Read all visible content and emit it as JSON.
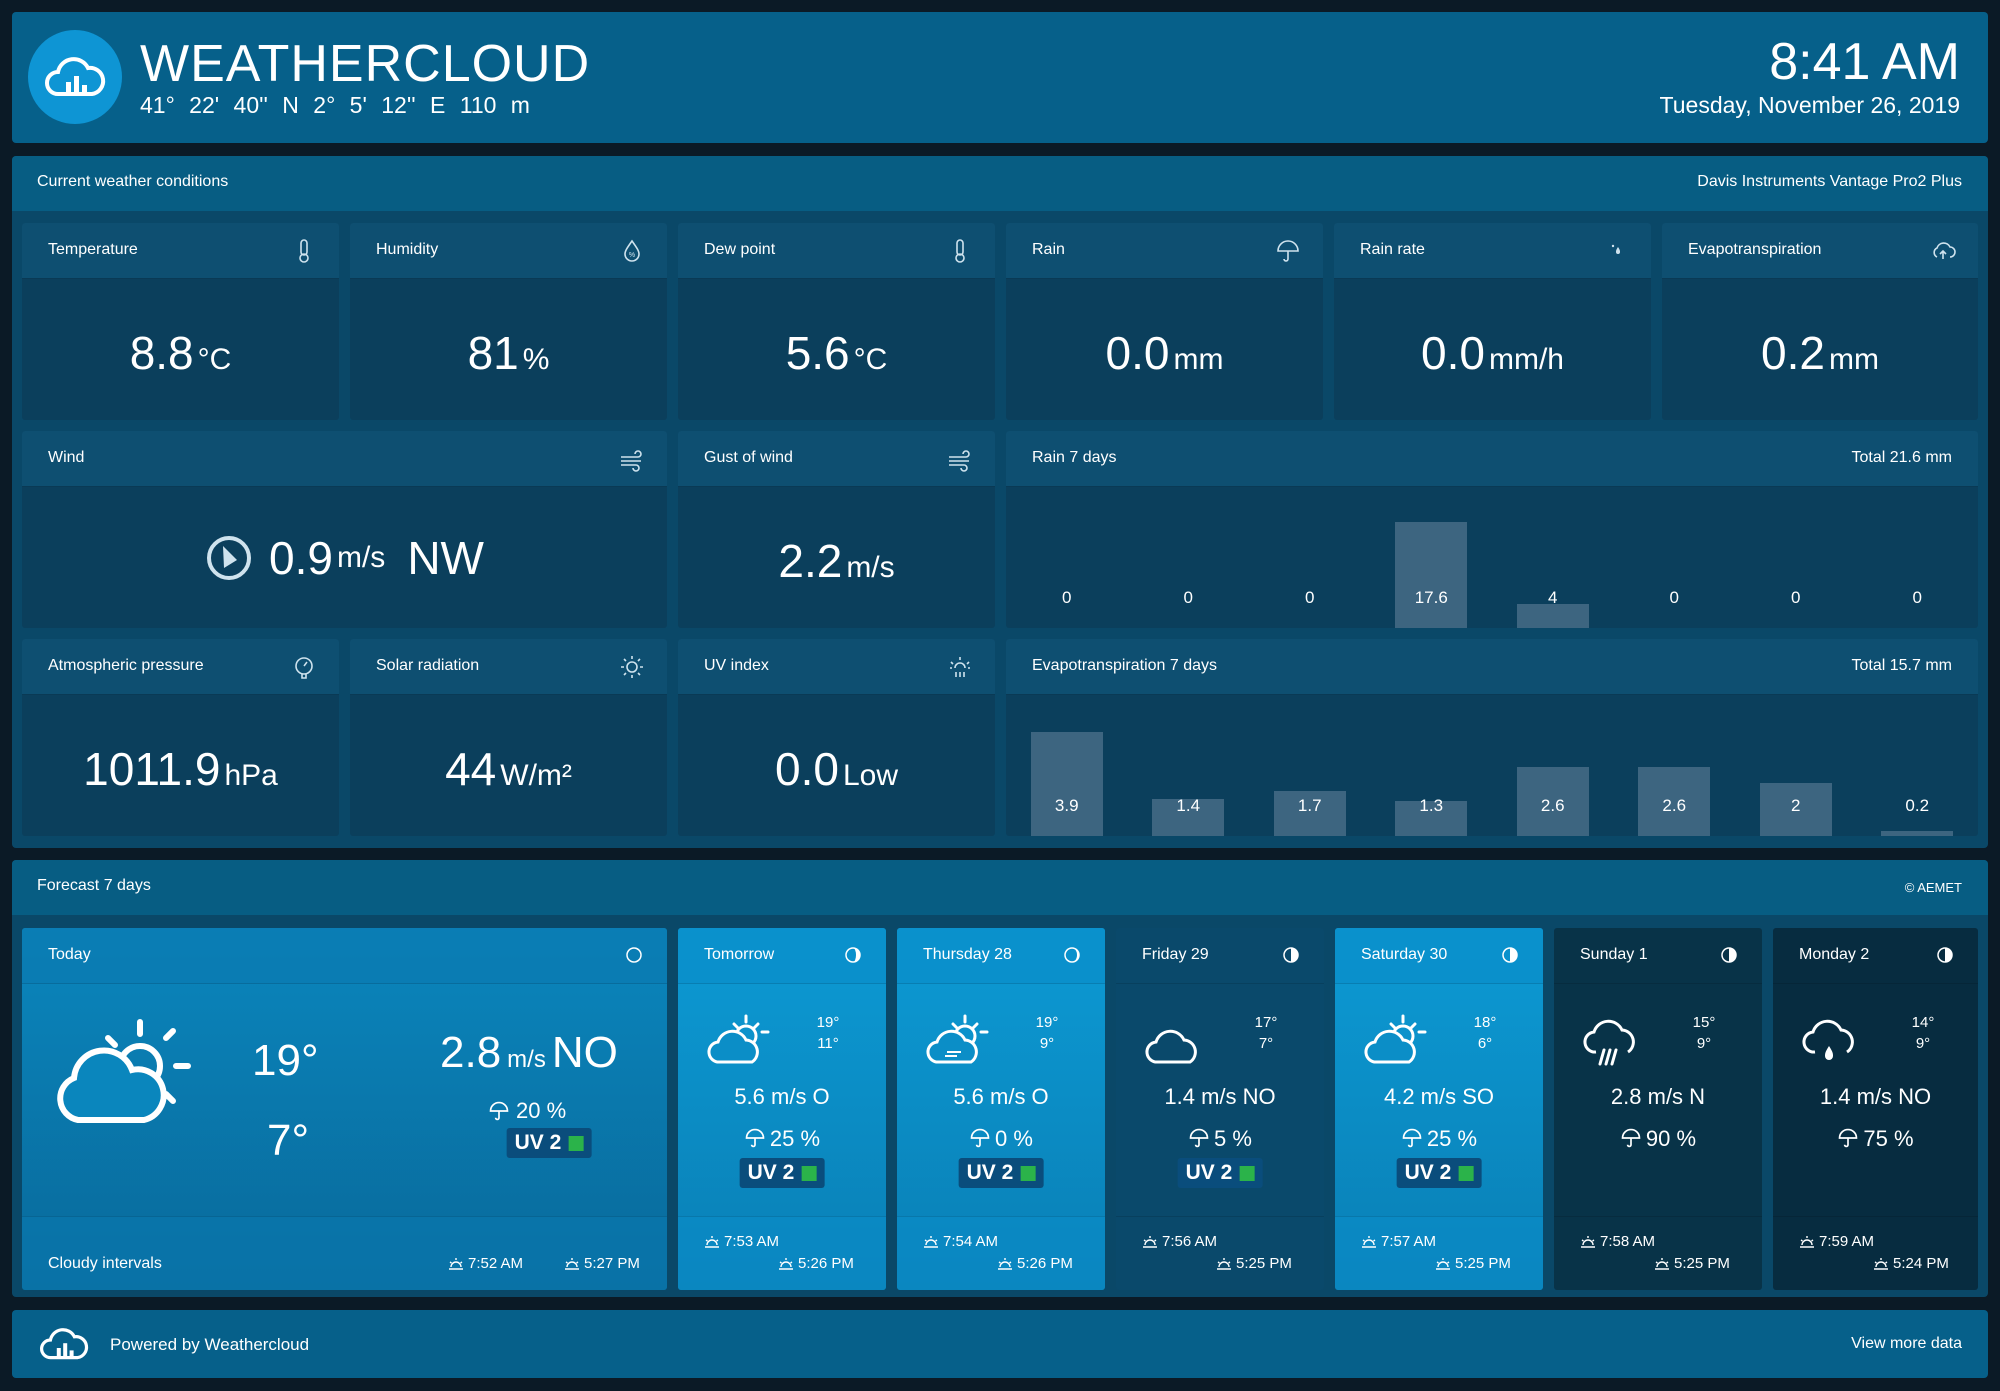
{
  "header": {
    "title": "WEATHERCLOUD",
    "coordinates": "41° 22' 40'' N   2° 5' 12'' E   110 m",
    "time": "8:41 AM",
    "date": "Tuesday, November 26, 2019"
  },
  "current": {
    "title": "Current weather conditions",
    "station": "Davis Instruments Vantage Pro2 Plus",
    "temperature": {
      "label": "Temperature",
      "value": "8.8",
      "unit": "°C"
    },
    "humidity": {
      "label": "Humidity",
      "value": "81",
      "unit": "%"
    },
    "dew_point": {
      "label": "Dew point",
      "value": "5.6",
      "unit": "°C"
    },
    "rain": {
      "label": "Rain",
      "value": "0.0",
      "unit": "mm"
    },
    "rain_rate": {
      "label": "Rain rate",
      "value": "0.0",
      "unit": "mm/h"
    },
    "evapotranspiration": {
      "label": "Evapotranspiration",
      "value": "0.2",
      "unit": "mm"
    },
    "wind": {
      "label": "Wind",
      "value": "0.9",
      "unit": "m/s",
      "direction": "NW"
    },
    "gust": {
      "label": "Gust of wind",
      "value": "2.2",
      "unit": "m/s"
    },
    "pressure": {
      "label": "Atmospheric pressure",
      "value": "1011.9",
      "unit": "hPa"
    },
    "solar": {
      "label": "Solar radiation",
      "value": "44",
      "unit": "W/m²"
    },
    "uv": {
      "label": "UV index",
      "value": "0.0",
      "unit": "Low"
    },
    "rain7": {
      "label": "Rain 7 days",
      "total": "Total 21.6 mm"
    },
    "evap7": {
      "label": "Evapotranspiration 7 days",
      "total": "Total 15.7 mm"
    }
  },
  "chart_data": [
    {
      "type": "bar",
      "title": "Rain 7 days",
      "values": [
        0,
        0,
        0,
        17.6,
        4,
        0,
        0,
        0
      ],
      "ylim": [
        0,
        20
      ]
    },
    {
      "type": "bar",
      "title": "Evapotranspiration 7 days",
      "values": [
        3.9,
        1.4,
        1.7,
        1.3,
        2.6,
        2.6,
        2,
        0.2
      ],
      "ylim": [
        0,
        4.5
      ]
    }
  ],
  "forecast": {
    "title": "Forecast 7 days",
    "source": "© AEMET",
    "today": {
      "day": "Today",
      "max": "19°",
      "min": "7°",
      "wind_value": "2.8",
      "wind_unit": "m/s",
      "wind_dir": "NO",
      "rain": "20 %",
      "uv_label": "UV",
      "uv": "2",
      "description": "Cloudy intervals",
      "sunrise": "7:52 AM",
      "sunset": "5:27 PM"
    },
    "days": [
      {
        "day": "Tomorrow",
        "max": "19°",
        "min": "11°",
        "wind": "5.6 m/s O",
        "rain": "25 %",
        "uv_label": "UV",
        "uv": "2",
        "sunrise": "7:53 AM",
        "sunset": "5:26 PM"
      },
      {
        "day": "Thursday 28",
        "max": "19°",
        "min": "9°",
        "wind": "5.6 m/s O",
        "rain": "0 %",
        "uv_label": "UV",
        "uv": "2",
        "sunrise": "7:54 AM",
        "sunset": "5:26 PM"
      },
      {
        "day": "Friday 29",
        "max": "17°",
        "min": "7°",
        "wind": "1.4 m/s NO",
        "rain": "5 %",
        "uv_label": "UV",
        "uv": "2",
        "sunrise": "7:56 AM",
        "sunset": "5:25 PM"
      },
      {
        "day": "Saturday 30",
        "max": "18°",
        "min": "6°",
        "wind": "4.2 m/s SO",
        "rain": "25 %",
        "uv_label": "UV",
        "uv": "2",
        "sunrise": "7:57 AM",
        "sunset": "5:25 PM"
      },
      {
        "day": "Sunday 1",
        "max": "15°",
        "min": "9°",
        "wind": "2.8 m/s N",
        "rain": "90 %",
        "sunrise": "7:58 AM",
        "sunset": "5:25 PM"
      },
      {
        "day": "Monday 2",
        "max": "14°",
        "min": "9°",
        "wind": "1.4 m/s NO",
        "rain": "75 %",
        "sunrise": "7:59 AM",
        "sunset": "5:24 PM"
      }
    ]
  },
  "footer": {
    "powered": "Powered by Weathercloud",
    "more": "View more data"
  },
  "colors": {
    "header": "#06608a",
    "section": "#0a4868",
    "card": "#0b3f5c",
    "bar": "#3d6580",
    "uv_low": "#2bb34a"
  }
}
